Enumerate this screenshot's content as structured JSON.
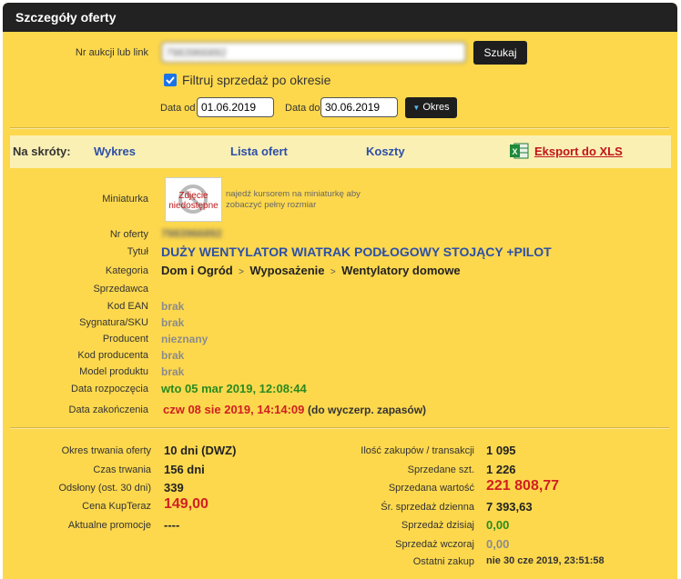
{
  "header": {
    "title": "Szczegóły oferty"
  },
  "search": {
    "label": "Nr aukcji lub link",
    "value": "7983966892",
    "button": "Szukaj",
    "filter_label": "Filtruj sprzedaż po okresie",
    "filter_checked": true,
    "date_from_label": "Data od",
    "date_from": "01.06.2019",
    "date_to_label": "Data do",
    "date_to": "30.06.2019",
    "period_button": "Okres"
  },
  "shortcuts": {
    "label": "Na skróty:",
    "chart": "Wykres",
    "offers": "Lista ofert",
    "costs": "Koszty",
    "export": "Eksport do XLS"
  },
  "offer": {
    "thumb_label": "Miniaturka",
    "thumb_text": "Zdjęcie niedostępne",
    "thumb_hint": "najedź kursorem na miniaturkę aby zobaczyć pełny rozmiar",
    "id_label": "Nr oferty",
    "id_value": "7983966892",
    "title_label": "Tytuł",
    "title_value": "DUŻY WENTYLATOR WIATRAK PODŁOGOWY STOJĄCY +PILOT",
    "category_label": "Kategoria",
    "cat1": "Dom i Ogród",
    "cat2": "Wyposażenie",
    "cat3": "Wentylatory domowe",
    "seller_label": "Sprzedawca",
    "ean_label": "Kod EAN",
    "ean_value": "brak",
    "sku_label": "Sygnatura/SKU",
    "sku_value": "brak",
    "producer_label": "Producent",
    "producer_value": "nieznany",
    "pcode_label": "Kod producenta",
    "pcode_value": "brak",
    "model_label": "Model produktu",
    "model_value": "brak",
    "start_label": "Data rozpoczęcia",
    "start_value": "wto 05 mar 2019, 12:08:44",
    "end_label": "Data zakończenia",
    "end_value": "czw 08 sie 2019, 14:14:09",
    "end_note": "(do wyczerp. zapasów)"
  },
  "stats_left": {
    "duration_label": "Okres trwania oferty",
    "duration_value": "10 dni (DWZ)",
    "time_label": "Czas trwania",
    "time_value": "156 dni",
    "views_label": "Odsłony (ost. 30 dni)",
    "views_value": "339",
    "price_label": "Cena KupTeraz",
    "price_value": "149,00",
    "promo_label": "Aktualne promocje",
    "promo_value": "----"
  },
  "stats_right": {
    "count_label": "Ilość zakupów / transakcji",
    "count_value": "1 095",
    "sold_label": "Sprzedane szt.",
    "sold_value": "1 226",
    "value_label": "Sprzedana wartość",
    "value_value": "221 808,77",
    "avg_label": "Śr. sprzedaż dzienna",
    "avg_value": "7 393,63",
    "today_label": "Sprzedaż dzisiaj",
    "today_value": "0,00",
    "yday_label": "Sprzedaż wczoraj",
    "yday_value": "0,00",
    "last_label": "Ostatni zakup",
    "last_value": "nie 30 cze 2019, 23:51:58"
  },
  "colors": {
    "panel": "#fdd84d",
    "link": "#2c4fa8",
    "green": "#2a8a1f",
    "red": "#d02020",
    "export": "#c0141c"
  }
}
